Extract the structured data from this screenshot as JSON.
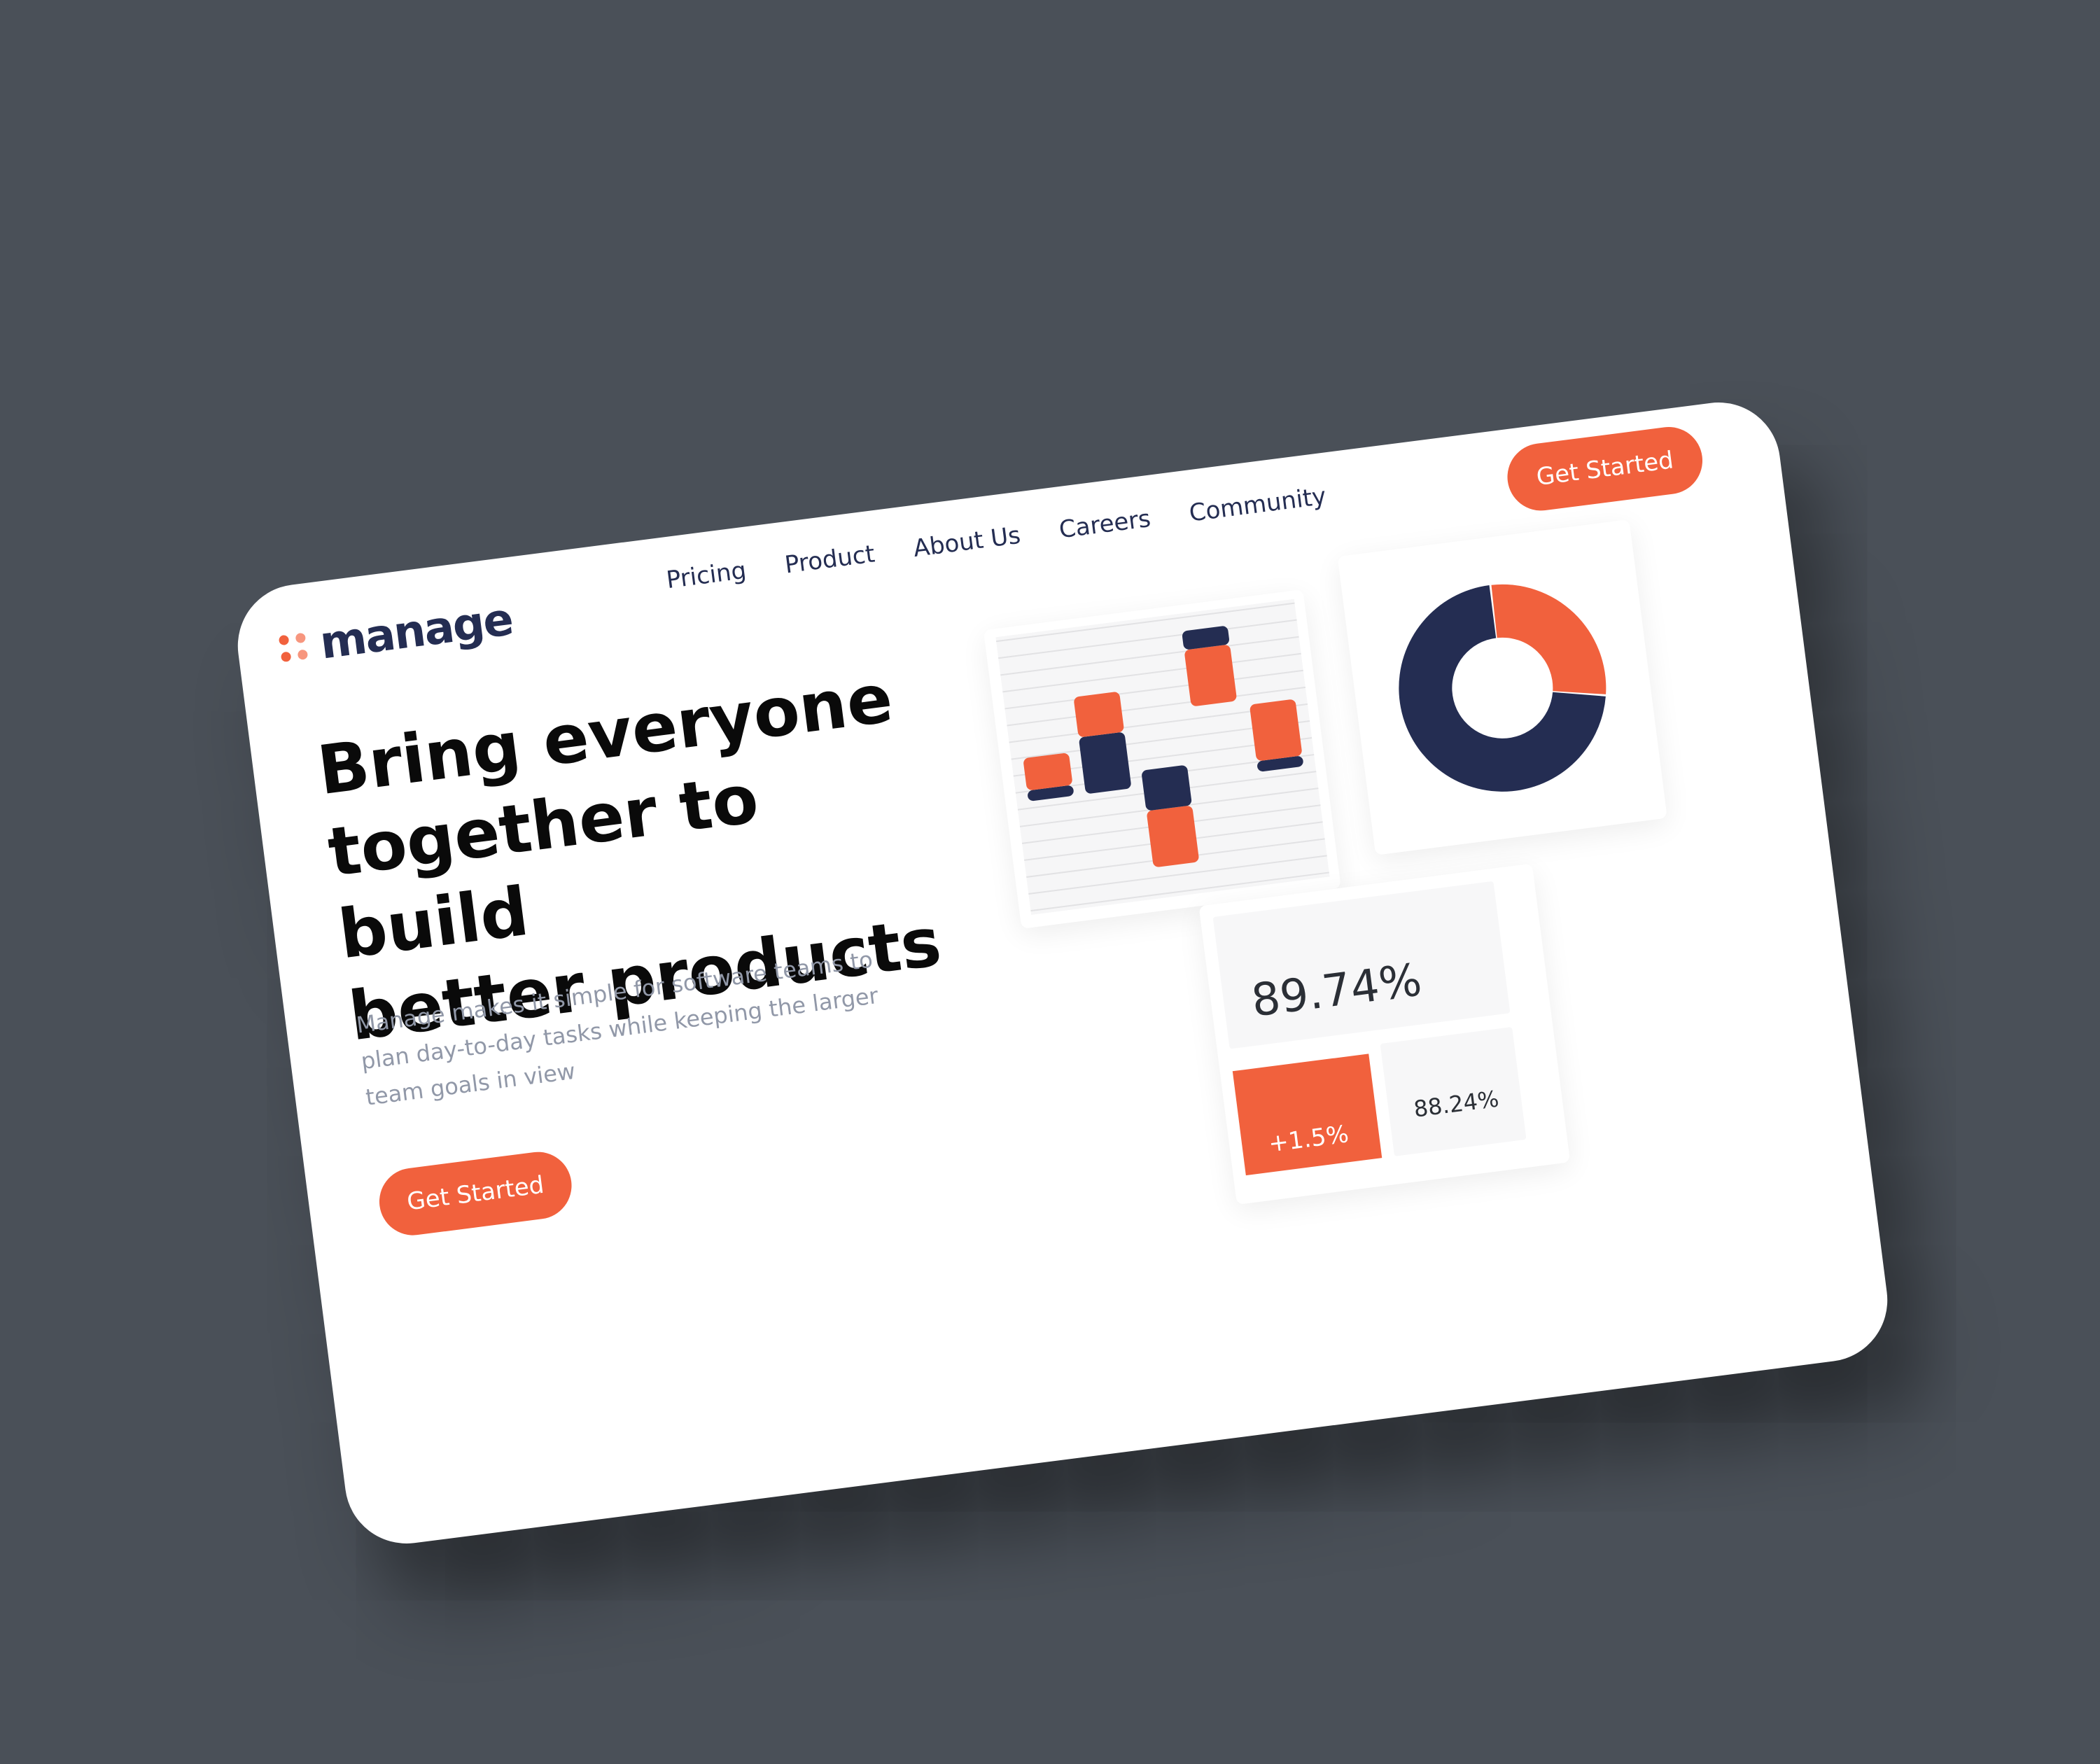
{
  "brand": {
    "name": "manage",
    "colors": {
      "accent": "#f1613d",
      "accent_light": "#f7967e",
      "navy": "#242d52",
      "background": "#4a5058"
    }
  },
  "nav": {
    "items": [
      "Pricing",
      "Product",
      "About Us",
      "Careers",
      "Community"
    ]
  },
  "header": {
    "cta_label": "Get Started"
  },
  "hero": {
    "headline_lines": [
      "Bring everyone",
      "together to build",
      "better products"
    ],
    "subtext": "Manage makes it simple for software teams to plan day-to-day tasks while keeping the larger team goals in view",
    "cta_label": "Get Started"
  },
  "chart_data": [
    {
      "type": "bar",
      "chart": "floating-stacked",
      "grid": true,
      "bars": [
        {
          "bottom": 1.0,
          "navy": 0.2,
          "orange": 0.6,
          "navy_position": "bottom"
        },
        {
          "bottom": 1.0,
          "navy": 1.05,
          "orange": 0.75,
          "navy_position": "bottom"
        },
        {
          "bottom": -0.5,
          "navy": 0.75,
          "orange": 1.05,
          "navy_position": "top"
        },
        {
          "bottom": 2.35,
          "navy": 0.35,
          "orange": 1.05,
          "navy_position": "top"
        },
        {
          "bottom": 1.0,
          "navy": 0.2,
          "orange": 1.05,
          "navy_position": "bottom"
        }
      ]
    },
    {
      "type": "pie",
      "style": "donut",
      "slices": [
        {
          "color": "navy",
          "value": 0.72
        },
        {
          "color": "orange",
          "value": 0.28
        }
      ]
    }
  ],
  "stats": {
    "main_value": "89.74%",
    "change_value": "+1.5%",
    "secondary_value": "88.24%"
  }
}
